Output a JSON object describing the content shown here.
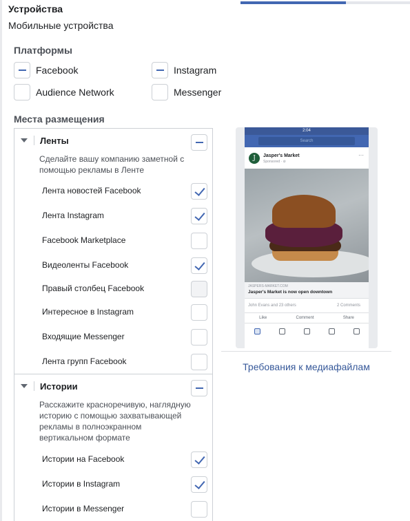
{
  "progress": {
    "fraction": 0.62
  },
  "devices": {
    "label": "Устройства",
    "value": "Мобильные устройства"
  },
  "platforms": {
    "title": "Платформы",
    "items": [
      {
        "label": "Facebook",
        "state": "minus"
      },
      {
        "label": "Instagram",
        "state": "minus"
      },
      {
        "label": "Audience Network",
        "state": "unchecked"
      },
      {
        "label": "Messenger",
        "state": "unchecked"
      }
    ]
  },
  "placements": {
    "title": "Места размещения",
    "groups": [
      {
        "title": "Ленты",
        "toggle_state": "minus",
        "description": "Сделайте вашу компанию заметной с помощью рекламы в Ленте",
        "items": [
          {
            "label": "Лента новостей Facebook",
            "state": "checked"
          },
          {
            "label": "Лента Instagram",
            "state": "checked"
          },
          {
            "label": "Facebook Marketplace",
            "state": "unchecked"
          },
          {
            "label": "Видеоленты Facebook",
            "state": "checked"
          },
          {
            "label": "Правый столбец Facebook",
            "state": "disabled"
          },
          {
            "label": "Интересное в Instagram",
            "state": "unchecked"
          },
          {
            "label": "Входящие Messenger",
            "state": "unchecked"
          },
          {
            "label": "Лента групп Facebook",
            "state": "unchecked"
          }
        ]
      },
      {
        "title": "Истории",
        "toggle_state": "minus",
        "description": "Расскажите красноречивую, наглядную историю с помощью захватывающей рекламы в полноэкранном вертикальном формате",
        "items": [
          {
            "label": "Истории на Facebook",
            "state": "checked"
          },
          {
            "label": "Истории в Instagram",
            "state": "checked"
          },
          {
            "label": "Истории в Messenger",
            "state": "unchecked"
          }
        ]
      }
    ]
  },
  "preview": {
    "status_time": "2:04",
    "search_placeholder": "Search",
    "advertiser": "Jasper's Market",
    "sponsored": "Sponsored · ⊘",
    "url": "JASPERS-MARKET.COM",
    "headline": "Jasper's Market is now open downtown",
    "reactions": "John Evans and 23 others",
    "comments": "2 Comments",
    "like": "Like",
    "comment": "Comment",
    "share": "Share"
  },
  "media_requirements_link": "Требования к медиафайлам",
  "colors": {
    "accent": "#4267b2",
    "link": "#365899",
    "border": "#ccd0d5"
  }
}
